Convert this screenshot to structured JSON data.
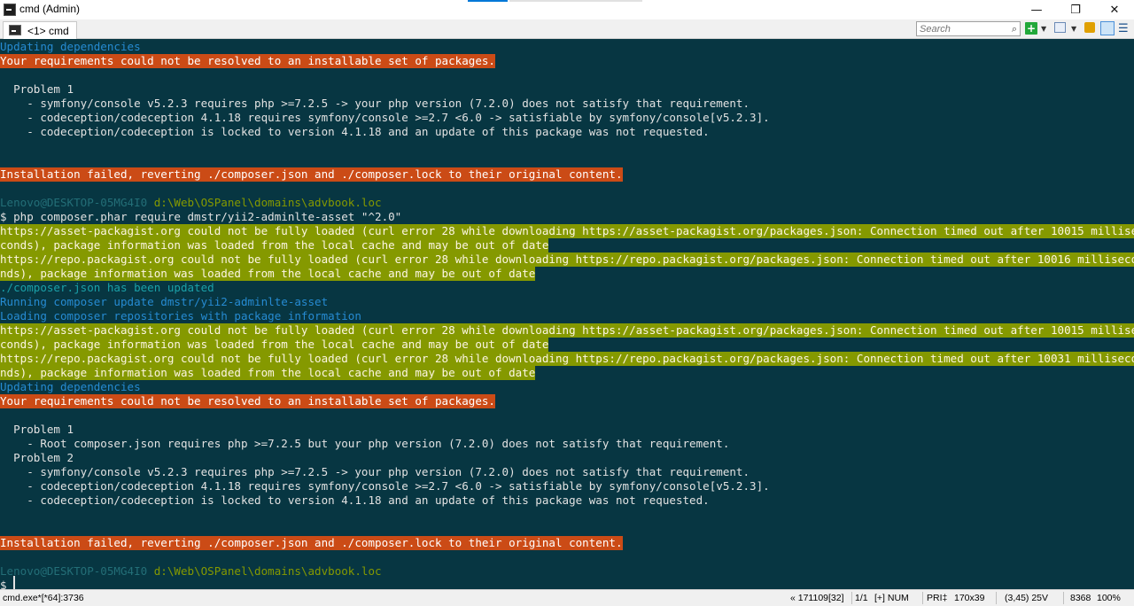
{
  "window": {
    "title": "cmd (Admin)",
    "minimize_glyph": "—",
    "restore_glyph": "❐",
    "close_glyph": "✕"
  },
  "tab": {
    "label": "<1> cmd"
  },
  "search": {
    "placeholder": "Search"
  },
  "toolbar": {
    "plus_glyph": "+",
    "dropdown_glyph": "▼",
    "menu_glyph": "☰"
  },
  "console": {
    "lines": [
      "Updating dependencies",
      "Your requirements could not be resolved to an installable set of packages.",
      "",
      "  Problem 1",
      "    - symfony/console v5.2.3 requires php >=7.2.5 -> your php version (7.2.0) does not satisfy that requirement.",
      "    - codeception/codeception 4.1.18 requires symfony/console >=2.7 <6.0 -> satisfiable by symfony/console[v5.2.3].",
      "    - codeception/codeception is locked to version 4.1.18 and an update of this package was not requested.",
      "",
      "",
      "Installation failed, reverting ./composer.json and ./composer.lock to their original content.",
      "",
      "Lenovo@DESKTOP-05MG4I0",
      "d:\\Web\\OSPanel\\domains\\advbook.loc",
      "$ php composer.phar require dmstr/yii2-adminlte-asset \"^2.0\"",
      "https://asset-packagist.org could not be fully loaded (curl error 28 while downloading https://asset-packagist.org/packages.json: Connection timed out after 10015 millise",
      "conds), package information was loaded from the local cache and may be out of date",
      "https://repo.packagist.org could not be fully loaded (curl error 28 while downloading https://repo.packagist.org/packages.json: Connection timed out after 10016 milliseco",
      "nds), package information was loaded from the local cache and may be out of date",
      "./composer.json has been updated",
      "Running composer update dmstr/yii2-adminlte-asset",
      "Loading composer repositories with package information",
      "https://asset-packagist.org could not be fully loaded (curl error 28 while downloading https://asset-packagist.org/packages.json: Connection timed out after 10015 millise",
      "conds), package information was loaded from the local cache and may be out of date",
      "https://repo.packagist.org could not be fully loaded (curl error 28 while downloading https://repo.packagist.org/packages.json: Connection timed out after 10031 milliseco",
      "nds), package information was loaded from the local cache and may be out of date",
      "Updating dependencies",
      "Your requirements could not be resolved to an installable set of packages.",
      "",
      "  Problem 1",
      "    - Root composer.json requires php >=7.2.5 but your php version (7.2.0) does not satisfy that requirement.",
      "  Problem 2",
      "    - symfony/console v5.2.3 requires php >=7.2.5 -> your php version (7.2.0) does not satisfy that requirement.",
      "    - codeception/codeception 4.1.18 requires symfony/console >=2.7 <6.0 -> satisfiable by symfony/console[v5.2.3].",
      "    - codeception/codeception is locked to version 4.1.18 and an update of this package was not requested.",
      "",
      "",
      "Installation failed, reverting ./composer.json and ./composer.lock to their original content.",
      "",
      "Lenovo@DESKTOP-05MG4I0",
      "d:\\Web\\OSPanel\\domains\\advbook.loc",
      "$ "
    ]
  },
  "status": {
    "process": "cmd.exe*[*64]:3736",
    "position": "« 171109[32]",
    "page": "1/1",
    "indicators": "[+] NUM",
    "priority": "PRI‡",
    "size": "170x39",
    "cursor": "(3,45) 25V",
    "memory": "8368",
    "zoom": "100%"
  },
  "colors": {
    "background": "#073642",
    "error_bg": "#cb4b16",
    "warning_bg": "#859900",
    "info": "#268bd2",
    "path": "#859900"
  }
}
